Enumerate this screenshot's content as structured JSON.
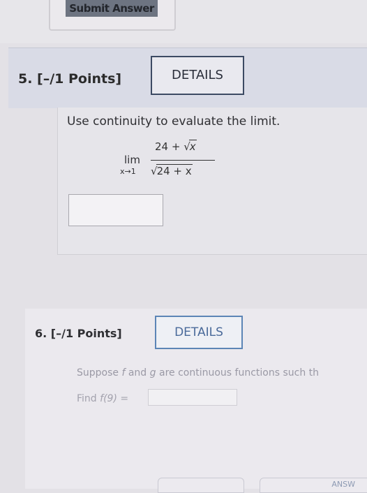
{
  "top": {
    "submit_label": "Submit Answer"
  },
  "q5": {
    "title": "5. [–/1 Points]",
    "details_label": "DETAILS",
    "prompt": "Use continuity to evaluate the limit.",
    "limit": {
      "lim": "lim",
      "approach": "x→1",
      "numerator_const": "24 + ",
      "numerator_var": "x",
      "denominator_expr": "24 + x"
    }
  },
  "q6": {
    "title": "6. [–/1 Points]",
    "details_label": "DETAILS",
    "text_prefix": "Suppose ",
    "f_var": "f",
    "text_mid": " and ",
    "g_var": "g",
    "text_suffix": " are continuous functions such th",
    "find_label": "Find ",
    "find_expr": "f(9) ="
  },
  "bottom": {
    "partial_label": "ANSW"
  }
}
